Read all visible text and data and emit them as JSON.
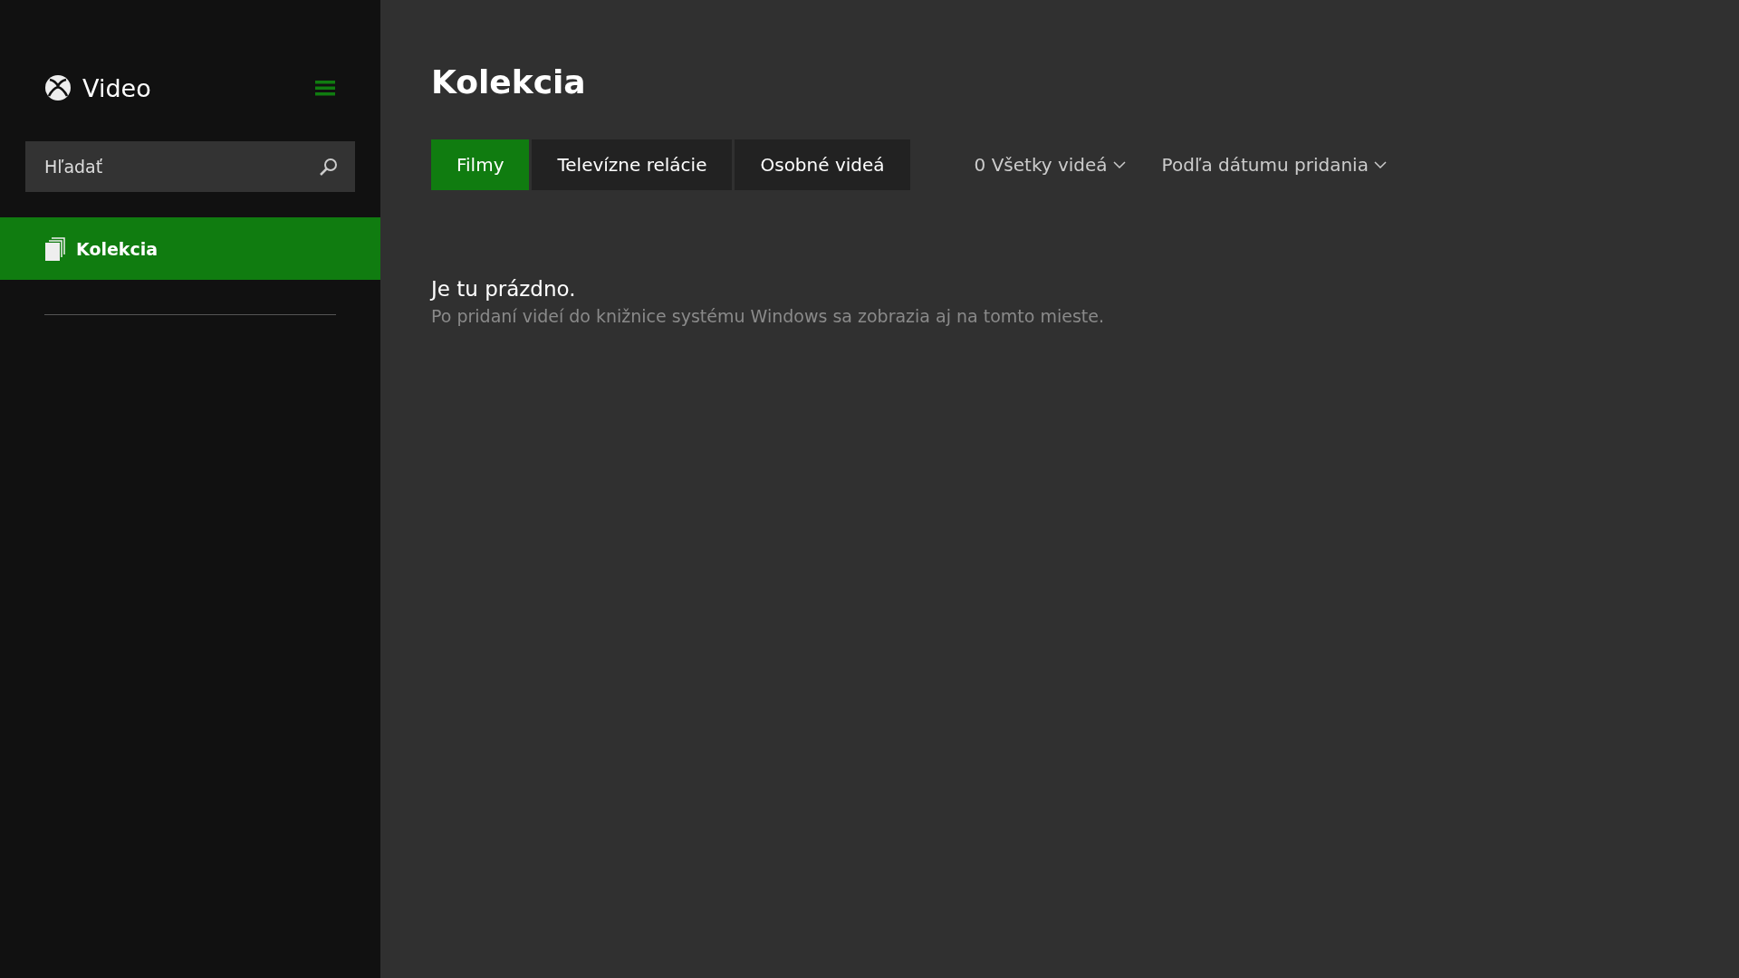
{
  "app": {
    "title": "Video"
  },
  "search": {
    "placeholder": "Hľadať"
  },
  "sidebar": {
    "items": [
      {
        "label": "Kolekcia",
        "selected": true
      }
    ]
  },
  "page": {
    "title": "Kolekcia"
  },
  "tabs": [
    {
      "label": "Filmy",
      "selected": true
    },
    {
      "label": "Televízne relácie",
      "selected": false
    },
    {
      "label": "Osobné videá",
      "selected": false
    }
  ],
  "filters": [
    {
      "label": "0 Všetky videá"
    },
    {
      "label": "Podľa dátumu pridania"
    }
  ],
  "empty_state": {
    "heading": "Je tu prázdno.",
    "message": "Po pridaní videí do knižnice systému Windows sa zobrazia aj na tomto mieste."
  }
}
